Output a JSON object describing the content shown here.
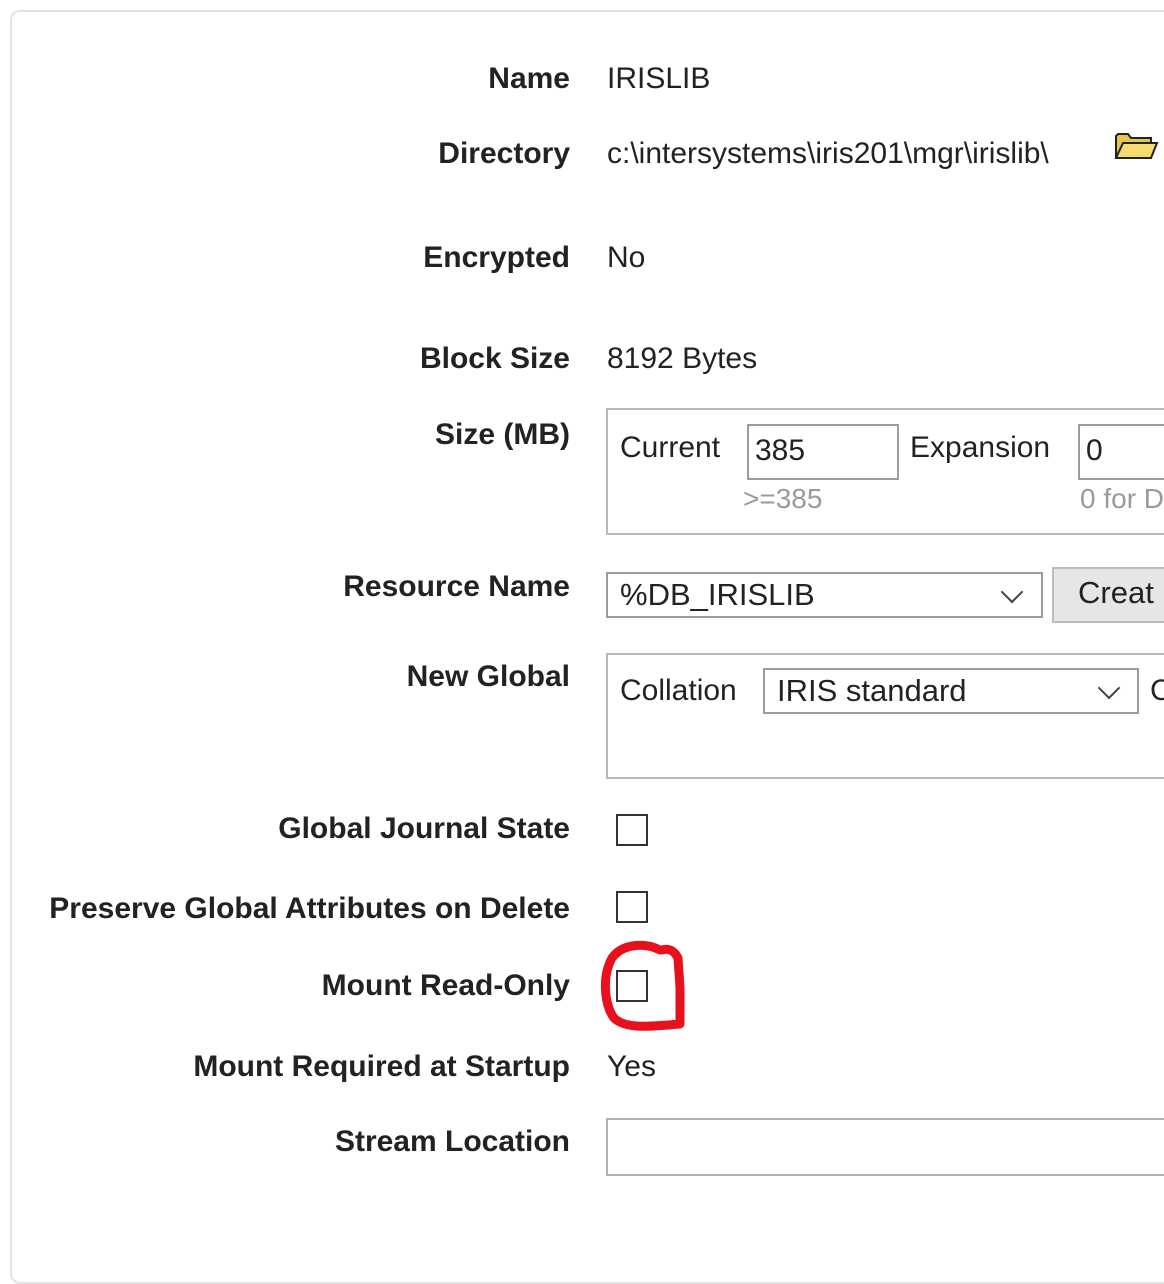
{
  "form": {
    "name": {
      "label": "Name",
      "value": "IRISLIB"
    },
    "directory": {
      "label": "Directory",
      "value": "c:\\intersystems\\iris201\\mgr\\irislib\\"
    },
    "encrypted": {
      "label": "Encrypted",
      "value": "No"
    },
    "block_size": {
      "label": "Block Size",
      "value": "8192 Bytes"
    },
    "size": {
      "label": "Size (MB)",
      "current_label": "Current",
      "current_value": "385",
      "current_hint": ">=385",
      "expansion_label": "Expansion",
      "expansion_value": "0",
      "expansion_hint": "0 for D"
    },
    "resource": {
      "label": "Resource Name",
      "selected": "%DB_IRISLIB",
      "create_button": "Creat"
    },
    "new_global": {
      "label": "New Global",
      "collation_label": "Collation",
      "collation_selected": "IRIS standard",
      "cut_text": "C"
    },
    "global_journal_state": {
      "label": "Global Journal State",
      "checked": false
    },
    "preserve_attrs": {
      "label": "Preserve Global Attributes on Delete",
      "checked": false
    },
    "mount_read_only": {
      "label": "Mount Read-Only",
      "checked": false
    },
    "mount_required": {
      "label": "Mount Required at Startup",
      "value": "Yes"
    },
    "stream_location": {
      "label": "Stream Location",
      "value": ""
    }
  },
  "annotation": {
    "color": "#e8101c"
  },
  "icons": {
    "directory_browse": "folder-icon"
  }
}
